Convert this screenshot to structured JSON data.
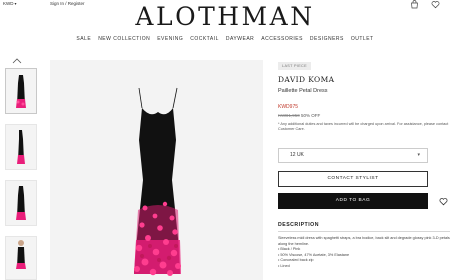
{
  "topbar": {
    "currency": "KWD",
    "signin": "Sign In / Register"
  },
  "logo": "ALOTHMAN",
  "nav": [
    "SALE",
    "NEW COLLECTION",
    "EVENING",
    "COCKTAIL",
    "DAYWEAR",
    "ACCESSORIES",
    "DESIGNERS",
    "OUTLET"
  ],
  "product": {
    "badge": "LAST PIECE",
    "brand": "DAVID KOMA",
    "name": "Paillette Petal Dress",
    "price": "KWD975",
    "old_price": "KWD1,950",
    "discount": "50% OFF",
    "note": "* Any additional duties and taxes incurred will be charged upon arrival. For assistance, please contact Customer Care.",
    "size": "12 UK",
    "contact_label": "CONTACT STYLIST",
    "add_label": "ADD TO BAG",
    "description_title": "DESCRIPTION",
    "description_text": "Sleeveless midi dress with spaghetti straps, a bra bodice, back slit and degrade glossy pink 3-D petals along the hemline.",
    "bullets": [
      "• Black / Pink",
      "• 50% Viscose, 47% Acetate, 3% Elastane",
      "• Concealed back zip",
      "• Lined"
    ]
  },
  "colors": {
    "accent_red": "#c0392b",
    "dress_black": "#111111",
    "petal_pink": "#e91e7a"
  }
}
